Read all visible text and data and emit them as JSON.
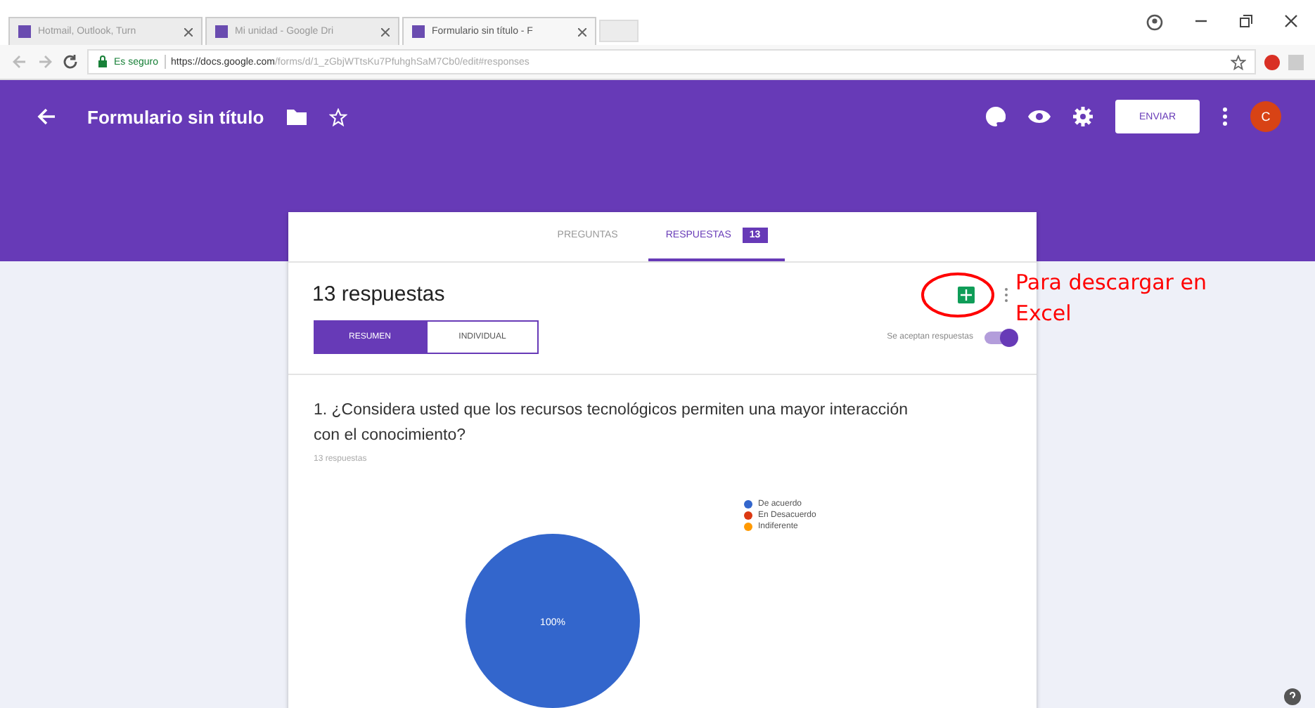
{
  "browser": {
    "tabs": [
      {
        "title": "Hotmail, Outlook, Turn",
        "selected": false
      },
      {
        "title": "Mi unidad - Google Dri",
        "selected": false
      },
      {
        "title": "Formulario sin título - F",
        "selected": true
      }
    ],
    "address": {
      "secure_label": "Es seguro",
      "host": "https://docs.google.com",
      "path": "/forms/d/1_zGbjWTtsKu7PfuhghSaM7Cb0/edit#responses"
    }
  },
  "header": {
    "title": "Formulario sin título",
    "send_button": "ENVIAR",
    "avatar": "C"
  },
  "tabs": [
    {
      "label": "PREGUNTAS",
      "selected": false
    },
    {
      "label": "RESPUESTAS",
      "selected": true,
      "badge": "13"
    }
  ],
  "summary": {
    "title": "13 respuestas",
    "views": [
      {
        "label": "RESUMEN",
        "selected": true
      },
      {
        "label": "INDIVIDUAL",
        "selected": false
      }
    ],
    "accepting": {
      "label": "Se aceptan respuestas",
      "on": true
    }
  },
  "question": {
    "text": "1. ¿Considera usted que los recursos tecnológicos permiten una mayor interacción con el conocimiento?",
    "count": "13 respuestas",
    "chart_data": {
      "type": "pie",
      "categories": [
        "De acuerdo",
        "En Desacuerdo",
        "Indiferente"
      ],
      "values": [
        100,
        0,
        0
      ],
      "colors": [
        "#3366cc",
        "#dc3912",
        "#ff9900"
      ],
      "value_labels": [
        "100%",
        null,
        null
      ]
    }
  },
  "annotation": "Para descargar en Excel"
}
